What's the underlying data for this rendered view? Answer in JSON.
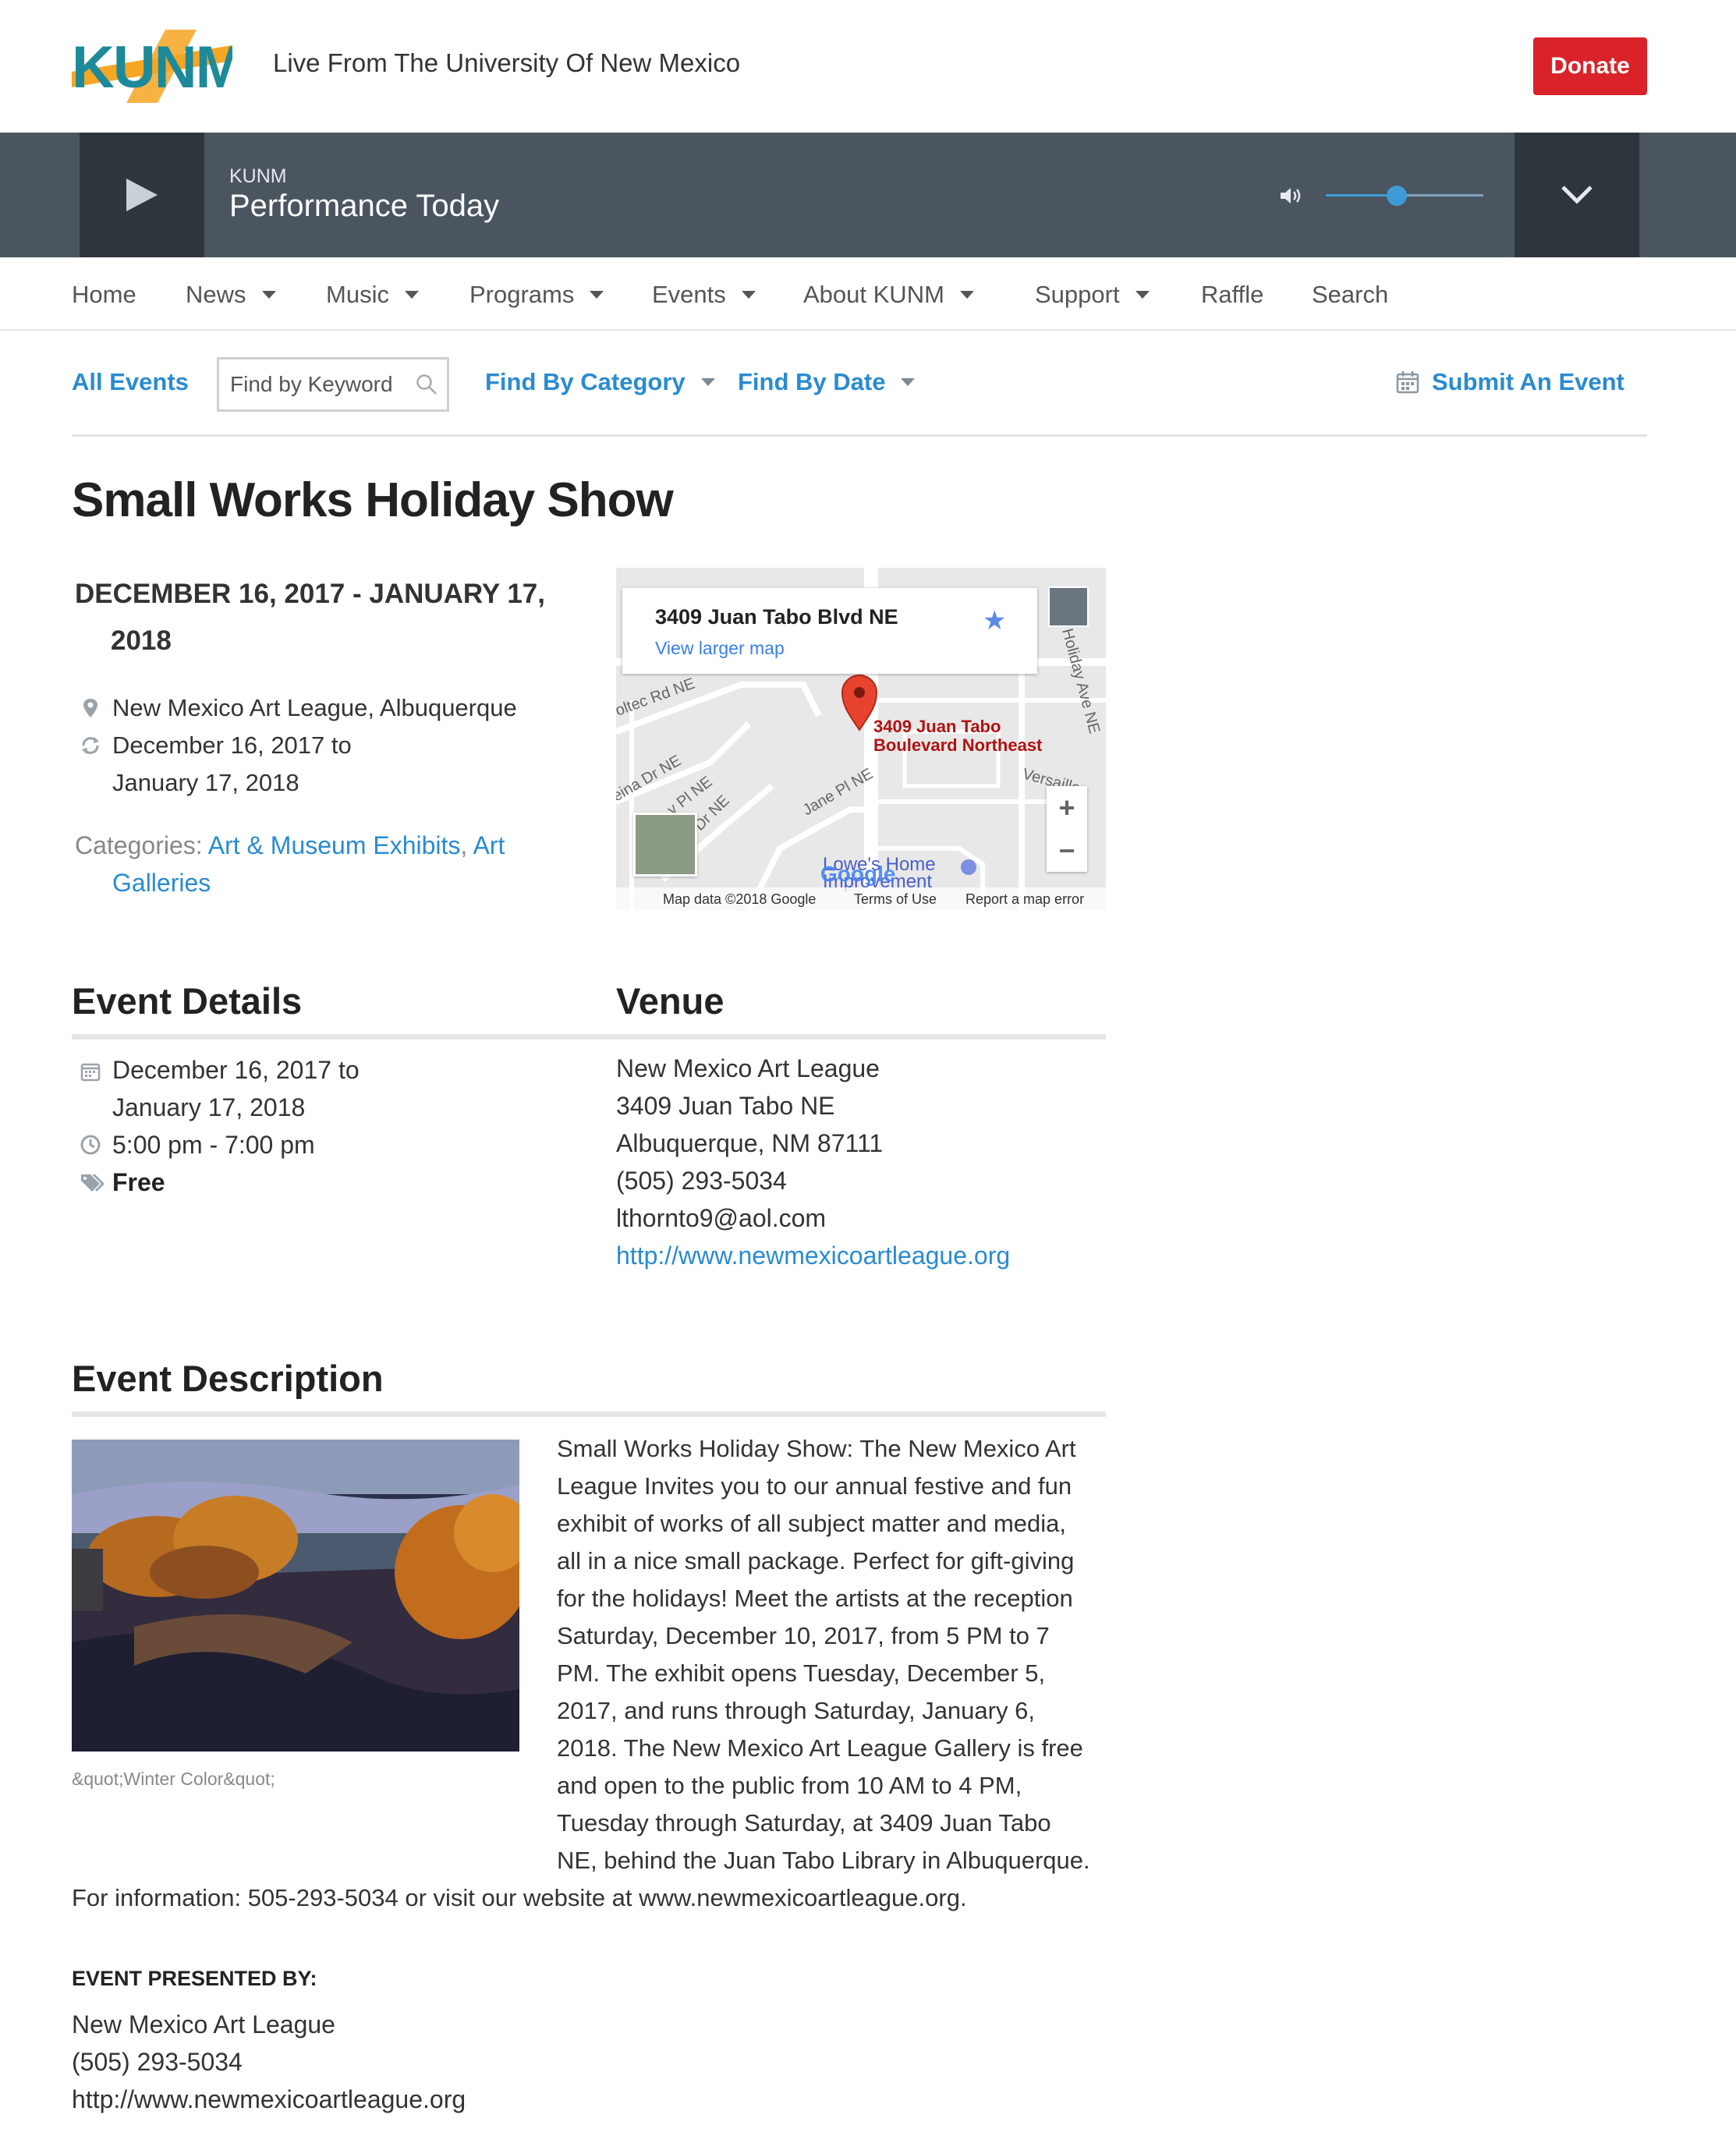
{
  "header": {
    "logo_text": "KUNM",
    "tagline": "Live From The University Of New Mexico",
    "donate_label": "Donate"
  },
  "player": {
    "station": "KUNM",
    "now_playing": "Performance Today",
    "volume_level": 0.45
  },
  "nav": {
    "items": [
      {
        "label": "Home"
      },
      {
        "label": "News"
      },
      {
        "label": "Music"
      },
      {
        "label": "Programs"
      },
      {
        "label": "Events"
      },
      {
        "label": "About KUNM"
      },
      {
        "label": "Support"
      },
      {
        "label": "Raffle"
      },
      {
        "label": "Search"
      }
    ]
  },
  "event_toolbar": {
    "all_events": "All Events",
    "search_placeholder": "Find by Keyword",
    "find_by_category": "Find By Category",
    "find_by_date": "Find By Date",
    "submit_event": "Submit An Event"
  },
  "event": {
    "title": "Small Works Holiday Show",
    "date_range_line1": "DECEMBER 16, 2017 - JANUARY 17,",
    "date_range_line2": "2018",
    "location": "New Mexico Art League, Albuquerque",
    "recurrence_line1": "December 16, 2017 to",
    "recurrence_line2": "January 17, 2018",
    "categories_label": "Categories:",
    "category_1": "Art & Museum Exhibits",
    "category_2_part1": "Art",
    "category_2_part2": "Galleries"
  },
  "map": {
    "address": "3409 Juan Tabo Blvd NE",
    "view_larger": "View larger map",
    "place_line1": "3409 Juan Tabo",
    "place_line2": "Boulevard Northeast",
    "poi_line1": "Lowe's Home",
    "poi_line2": "Improvement",
    "google": "Google",
    "streets": [
      "oltec Rd NE",
      "eina Dr NE",
      "y Pl NE",
      "t Dr NE",
      "Jane Pl NE",
      "Holiday Ave NE",
      "Versailles"
    ],
    "footer_data": "Map data ©2018 Google",
    "footer_terms": "Terms of Use",
    "footer_report": "Report a map error"
  },
  "details": {
    "heading": "Event Details",
    "date_line1": "December 16, 2017 to",
    "date_line2": "January 17, 2018",
    "time": "5:00 pm - 7:00 pm",
    "price": "Free"
  },
  "venue": {
    "heading": "Venue",
    "name": "New Mexico Art League",
    "street": "3409 Juan Tabo NE",
    "city": "Albuquerque, NM 87111",
    "phone": "(505) 293-5034",
    "email": "lthornto9@aol.com",
    "website": "http://www.newmexicoartleague.org"
  },
  "description": {
    "heading": "Event Description",
    "image_caption": "&quot;Winter Color&quot;",
    "lines": [
      "Small Works Holiday Show: The New Mexico Art",
      "League Invites you to our annual festive and fun",
      "exhibit of works of all subject matter and media,",
      "all in a nice small package. Perfect for gift-giving",
      "for the holidays! Meet the artists at the reception",
      "Saturday, December 10, 2017, from 5 PM to 7",
      "PM. The exhibit opens Tuesday, December 5,",
      "2017, and runs through Saturday, January 6,",
      "2018. The New Mexico Art League Gallery is free",
      "and open to the public from 10 AM to 4 PM,",
      "Tuesday through Saturday, at 3409 Juan Tabo",
      "NE, behind the Juan Tabo Library in Albuquerque.",
      "For information: 505-293-5034 or visit our website at www.newmexicoartleague.org."
    ]
  },
  "presented_by": {
    "label": "EVENT PRESENTED BY:",
    "name": "New Mexico Art League",
    "phone": "(505) 293-5034",
    "website": "http://www.newmexicoartleague.org"
  },
  "colors": {
    "accent_blue": "#2a8bd1",
    "donate_red": "#d9222a",
    "player_bg": "#4a5560",
    "player_dark": "#2e363d"
  }
}
